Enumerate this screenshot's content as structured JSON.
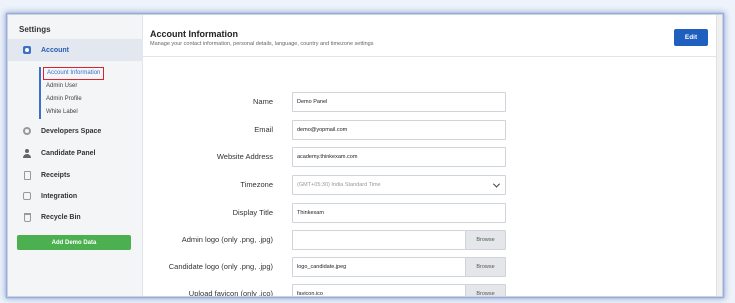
{
  "sidebar": {
    "title": "Settings",
    "account_label": "Account",
    "account_sub": [
      "Account Information",
      "Admin User",
      "Admin Profile",
      "White Label"
    ],
    "items": [
      {
        "label": "Developers Space",
        "icon": "gear-icon"
      },
      {
        "label": "Candidate Panel",
        "icon": "person-icon"
      },
      {
        "label": "Receipts",
        "icon": "receipt-icon"
      },
      {
        "label": "Integration",
        "icon": "integration-icon"
      },
      {
        "label": "Recycle Bin",
        "icon": "trash-icon"
      }
    ],
    "demo_button": "Add Demo Data"
  },
  "header": {
    "title": "Account Information",
    "subtitle": "Manage your contact information, personal details, language, country and timezone settings",
    "edit_label": "Edit"
  },
  "form": {
    "name": {
      "label": "Name",
      "value": "Demo Panel"
    },
    "email": {
      "label": "Email",
      "value": "demo@yopmail.com"
    },
    "website": {
      "label": "Website Address",
      "value": "academy.thinkexam.com"
    },
    "timezone": {
      "label": "Timezone",
      "value": "(GMT+05:30) India Standard Time"
    },
    "display_title": {
      "label": "Display Title",
      "value": "Thinkexam"
    },
    "admin_logo": {
      "label": "Admin logo (only .png, .jpg)",
      "value": "",
      "browse": "Browse"
    },
    "candidate_logo": {
      "label": "Candidate logo (only .png, .jpg)",
      "value": "logo_candidate.jpeg",
      "browse": "Browse"
    },
    "favicon": {
      "label": "Upload favicon (only .ico)",
      "value": "favicon.ico",
      "browse": "Browse"
    }
  },
  "colors": {
    "accent": "#1f5fbf",
    "active_outline": "#d9232e",
    "demo_button": "#4caf50"
  }
}
